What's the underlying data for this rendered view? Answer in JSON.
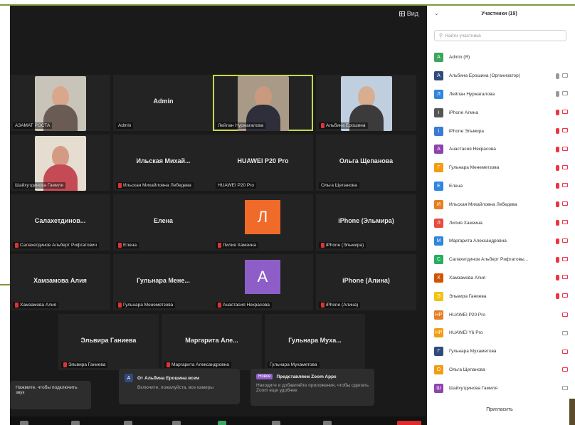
{
  "toolbar": {
    "view_label": "Вид"
  },
  "tiles": [
    {
      "name": "",
      "label": "АЗАМАТ РОСТА"
    },
    {
      "name": "Admin",
      "label": "Admin"
    },
    {
      "name": "",
      "label": "Лейлан Нуржагалова"
    },
    {
      "name": "",
      "label": "Альбина Ерошина"
    },
    {
      "name": "",
      "label": "Шайхутдинова Гамиля"
    },
    {
      "name": "Ильская Михай...",
      "label": "Ильская Михайловна Лебедева"
    },
    {
      "name": "HUAWEI P20 Pro",
      "label": "HUAWEI P20 Pro"
    },
    {
      "name": "Ольга Щепанова",
      "label": "Ольга Щепанова"
    },
    {
      "name": "Салахетдинов...",
      "label": "Салахетдинов Альберт Рифгатович"
    },
    {
      "name": "Елена",
      "label": "Елена"
    },
    {
      "name": "",
      "label": "Лилия Хамзина",
      "letter": "Л"
    },
    {
      "name": "iPhone (Эльмира)",
      "label": "iPhone (Эльмира)"
    },
    {
      "name": "Хамзамова Алия",
      "label": "Хамзамова Алия"
    },
    {
      "name": "Гульнара Мене...",
      "label": "Гульнара Менеметзова"
    },
    {
      "name": "",
      "label": "Анастасия Некрасова",
      "letter": "А"
    },
    {
      "name": "iPhone (Алина)",
      "label": "iPhone (Алина)"
    },
    {
      "name": "Эльвира Ганиева",
      "label": "Эльвира Ганиева"
    },
    {
      "name": "Маргарита Але...",
      "label": "Маргарита Александровна"
    },
    {
      "name": "Гульнара Муха...",
      "label": "Гульнара Мухаметова"
    }
  ],
  "sidebar": {
    "title": "Участники (19)",
    "collapse": "⌄",
    "search_placeholder": "Найти участника",
    "invite_label": "Пригласить",
    "participants": [
      {
        "initial": "A",
        "name": "Admin (Я)",
        "color": "#3aa55c",
        "mic": "none",
        "video": "none"
      },
      {
        "initial": "А",
        "name": "Альбина Ерошина (Организатор)",
        "color": "#2f4b7c",
        "mic": "on",
        "video": "on"
      },
      {
        "initial": "Л",
        "name": "Лейлан Нуржагалова",
        "color": "#2e86de",
        "mic": "on",
        "video": "on"
      },
      {
        "initial": "i",
        "name": "iPhone Алина",
        "color": "#555555",
        "mic": "off",
        "video": "off"
      },
      {
        "initial": "i",
        "name": "iPhone Эльмира",
        "color": "#3a7bd5",
        "mic": "off",
        "video": "off"
      },
      {
        "initial": "А",
        "name": "Анастасия Некрасова",
        "color": "#8e44ad",
        "mic": "off",
        "video": "off"
      },
      {
        "initial": "Г",
        "name": "Гульнара Менеметзова",
        "color": "#f39c12",
        "mic": "off",
        "video": "off"
      },
      {
        "initial": "Е",
        "name": "Елена",
        "color": "#2e86de",
        "mic": "off",
        "video": "off"
      },
      {
        "initial": "И",
        "name": "Ильская Михайловна Лебедева",
        "color": "#e67e22",
        "mic": "off",
        "video": "off"
      },
      {
        "initial": "Л",
        "name": "Лилия Хамзина",
        "color": "#e74c3c",
        "mic": "off",
        "video": "off"
      },
      {
        "initial": "М",
        "name": "Маргарита Александровна",
        "color": "#2e86de",
        "mic": "off",
        "video": "off"
      },
      {
        "initial": "С",
        "name": "Салахетдинов Альберт Рифгатовы...",
        "color": "#27ae60",
        "mic": "off",
        "video": "off"
      },
      {
        "initial": "Х",
        "name": "Хамзамова Алия",
        "color": "#d35400",
        "mic": "off",
        "video": "off"
      },
      {
        "initial": "Э",
        "name": "Эльвира Ганиева",
        "color": "#f1c40f",
        "mic": "off",
        "video": "off"
      },
      {
        "initial": "HP",
        "name": "HUAWEI P20 Pro",
        "color": "#e67e22",
        "mic": "none",
        "video": "off"
      },
      {
        "initial": "HP",
        "name": "HUAWEI Y6 Pro",
        "color": "#f39c12",
        "mic": "none",
        "video": "on"
      },
      {
        "initial": "Г",
        "name": "Гульнара Мухаметова",
        "color": "#2f4b7c",
        "mic": "none",
        "video": "off"
      },
      {
        "initial": "О",
        "name": "Ольга Щепанова",
        "color": "#f39c12",
        "mic": "none",
        "video": "off"
      },
      {
        "initial": "Ш",
        "name": "Шайхутдинова Гамиля",
        "color": "#8e44ad",
        "mic": "none",
        "video": "on"
      }
    ]
  },
  "toasts": {
    "unmute": "Нажмите, чтобы подключить звук",
    "msg_from": "От Альбина Ерошина всем",
    "msg_text": "Включите, пожалуйста, все камеры",
    "apps_badge": "Новое",
    "apps_title": "Представляем Zoom Apps",
    "apps_text": "Находите и добавляйте приложения, чтобы сделать Zoom еще удобнее"
  }
}
